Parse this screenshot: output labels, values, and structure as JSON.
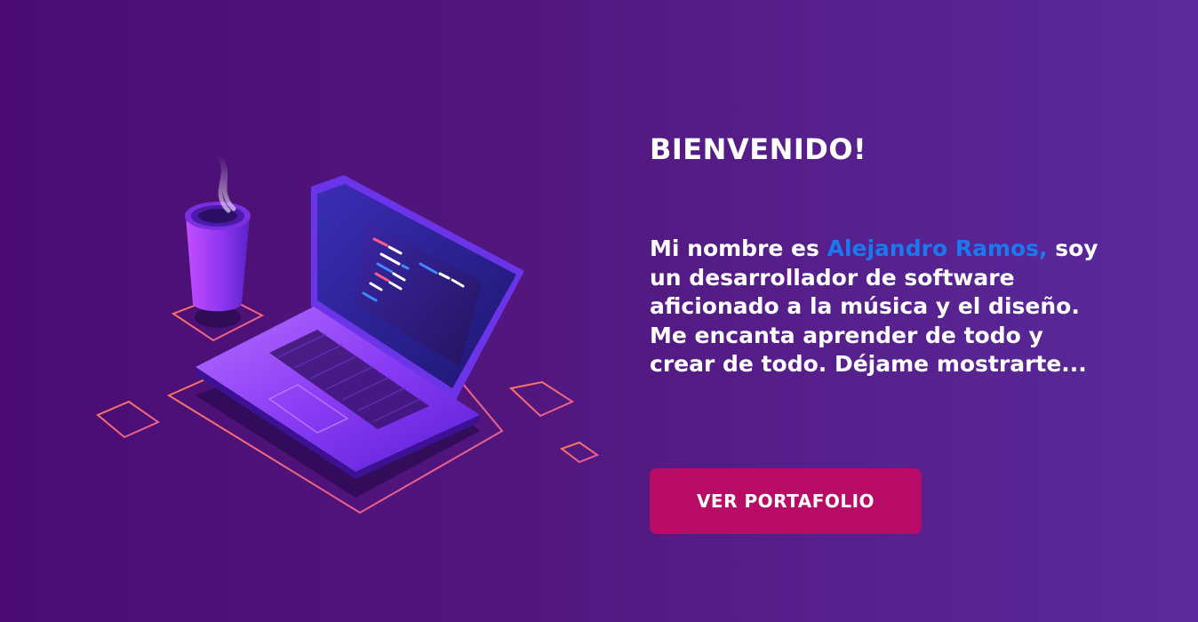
{
  "hero": {
    "title": "BIENVENIDO!",
    "intro_prefix": "Mi nombre es ",
    "name": "Alejandro Ramos,",
    "intro_suffix": " soy un desarrollador de software aficionado a la música y el diseño. Me encanta aprender de todo y crear de todo. Déjame mostrarte..."
  },
  "cta": {
    "label": "VER PORTAFOLIO"
  },
  "colors": {
    "background_start": "#4a0c72",
    "background_end": "#5b2a9c",
    "name_highlight": "#1a78f0",
    "button": "#b70b66"
  },
  "illustration": {
    "icons": [
      "laptop-icon",
      "coffee-cup-icon",
      "code-editor-icon"
    ]
  }
}
